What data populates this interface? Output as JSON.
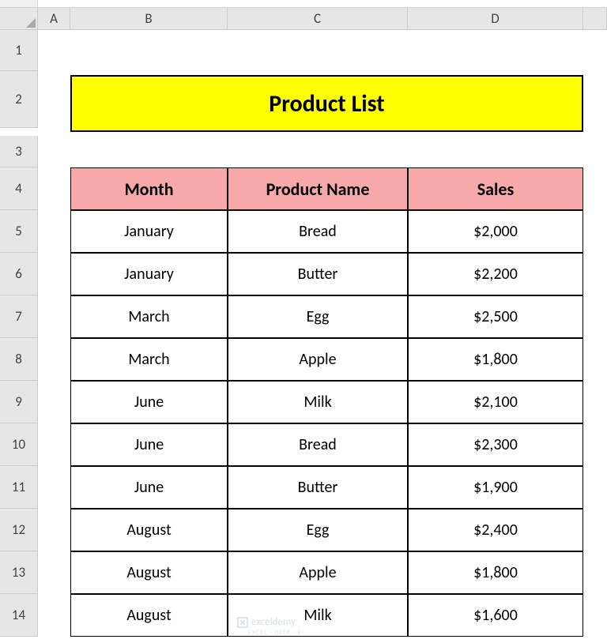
{
  "columns": [
    "A",
    "B",
    "C",
    "D"
  ],
  "rows": [
    "1",
    "2",
    "3",
    "4",
    "5",
    "6",
    "7",
    "8",
    "9",
    "10",
    "11",
    "12",
    "13",
    "14"
  ],
  "title": "Product List",
  "headers": {
    "month": "Month",
    "product": "Product Name",
    "sales": "Sales"
  },
  "data": [
    {
      "month": "January",
      "product": "Bread",
      "sales": "$2,000"
    },
    {
      "month": "January",
      "product": "Butter",
      "sales": "$2,200"
    },
    {
      "month": "March",
      "product": "Egg",
      "sales": "$2,500"
    },
    {
      "month": "March",
      "product": "Apple",
      "sales": "$1,800"
    },
    {
      "month": "June",
      "product": "Milk",
      "sales": "$2,100"
    },
    {
      "month": "June",
      "product": "Bread",
      "sales": "$2,300"
    },
    {
      "month": "June",
      "product": "Butter",
      "sales": "$1,900"
    },
    {
      "month": "August",
      "product": "Egg",
      "sales": "$2,400"
    },
    {
      "month": "August",
      "product": "Apple",
      "sales": "$1,800"
    },
    {
      "month": "August",
      "product": "Milk",
      "sales": "$1,600"
    }
  ],
  "watermark": "exceldemy",
  "watermark_sub": "EXCEL · DATA · BI"
}
